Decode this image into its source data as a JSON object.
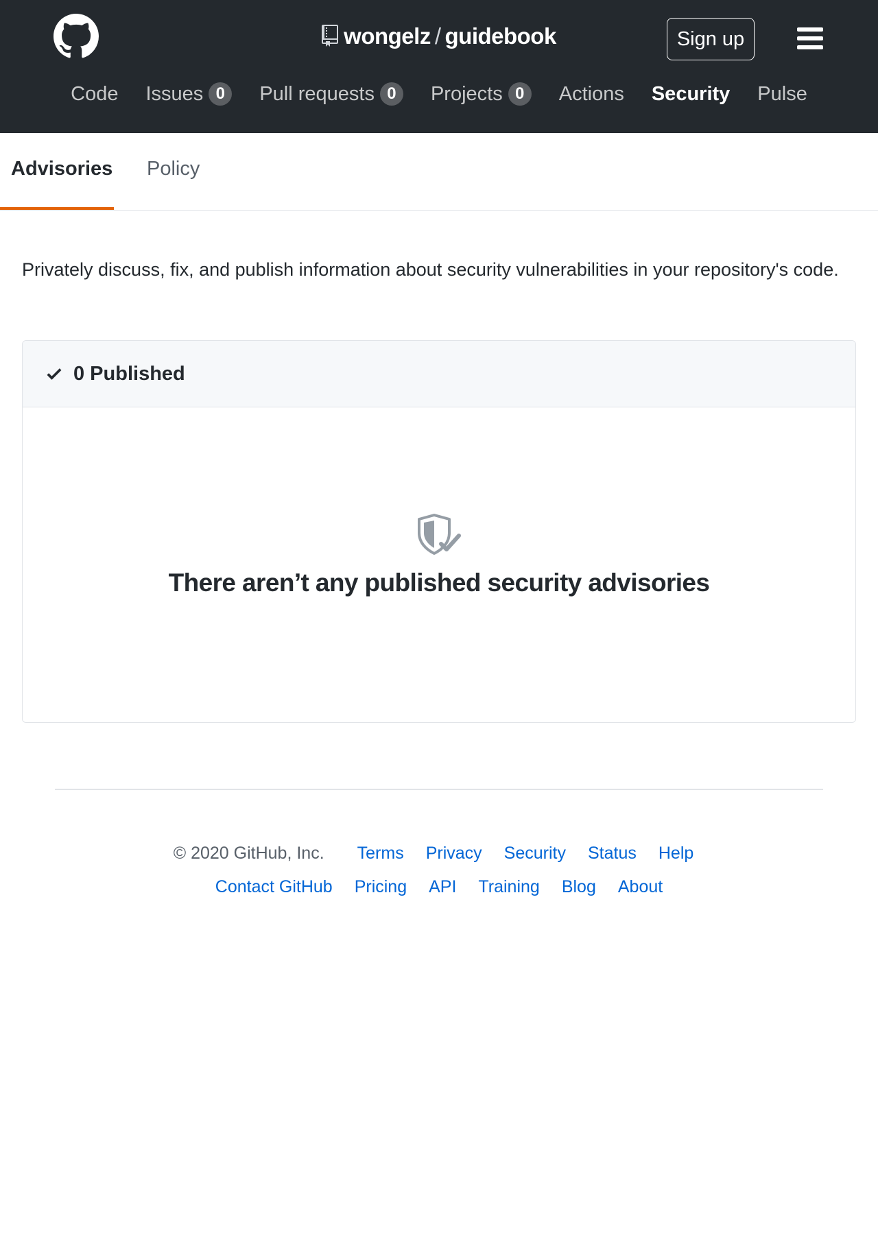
{
  "header": {
    "owner": "wongelz",
    "separator": "/",
    "repo": "guidebook",
    "signup_label": "Sign up"
  },
  "nav": [
    {
      "label": "Code",
      "count": null
    },
    {
      "label": "Issues",
      "count": "0"
    },
    {
      "label": "Pull requests",
      "count": "0"
    },
    {
      "label": "Projects",
      "count": "0"
    },
    {
      "label": "Actions",
      "count": null
    },
    {
      "label": "Security",
      "count": null,
      "selected": true
    },
    {
      "label": "Pulse",
      "count": null
    }
  ],
  "subnav": {
    "advisories": "Advisories",
    "policy": "Policy"
  },
  "intro": "Privately discuss, fix, and publish information about security vulnerabilities in your repository's code.",
  "box": {
    "header_label": "0 Published",
    "blank_title": "There aren’t any published security advisories"
  },
  "footer": {
    "copyright": "© 2020 GitHub, Inc.",
    "row1": [
      "Terms",
      "Privacy",
      "Security",
      "Status",
      "Help"
    ],
    "row2": [
      "Contact GitHub",
      "Pricing",
      "API",
      "Training",
      "Blog",
      "About"
    ]
  },
  "icons": {
    "logo": "github-mark-icon",
    "repo": "repo-icon",
    "menu": "hamburger-icon",
    "check": "check-icon",
    "shield": "shield-check-icon"
  },
  "colors": {
    "header_bg": "#24292e",
    "link": "#0366d6",
    "tab_underline": "#e36209"
  }
}
